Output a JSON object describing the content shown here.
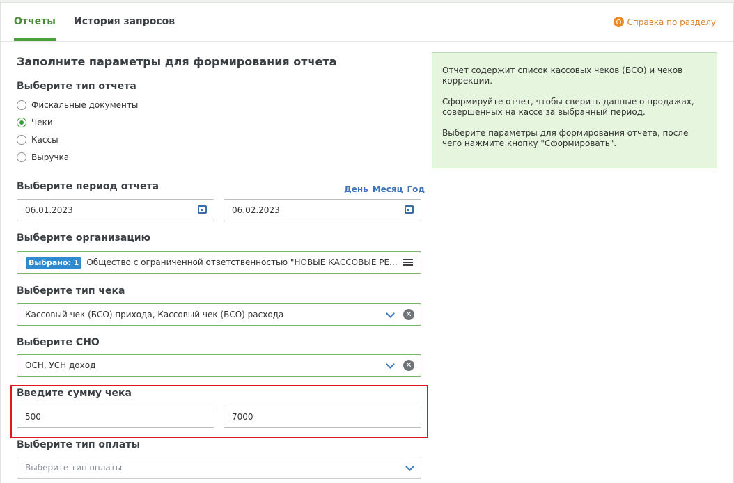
{
  "tabs": [
    {
      "label": "Отчеты",
      "active": true
    },
    {
      "label": "История запросов",
      "active": false
    }
  ],
  "help_link": "Справка по разделу",
  "form": {
    "title": "Заполните параметры для формирования отчета",
    "report_type": {
      "label": "Выберите тип отчета",
      "options": [
        {
          "label": "Фискальные документы",
          "checked": false
        },
        {
          "label": "Чеки",
          "checked": true
        },
        {
          "label": "Кассы",
          "checked": false
        },
        {
          "label": "Выручка",
          "checked": false
        }
      ]
    },
    "period": {
      "label": "Выберите период отчета",
      "quick_links": [
        "День",
        "Месяц",
        "Год"
      ],
      "from": "06.01.2023",
      "to": "06.02.2023"
    },
    "organization": {
      "label": "Выберите организацию",
      "badge": "Выбрано: 1",
      "value": "Общество с ограниченной ответственностью \"НОВЫЕ КАССОВЫЕ РЕ..."
    },
    "receipt_type": {
      "label": "Выберите тип чека",
      "value": "Кассовый чек (БСО) прихода, Кассовый чек (БСО) расхода"
    },
    "tax_system": {
      "label": "Выберите СНО",
      "value": "ОСН, УСН доход"
    },
    "amount": {
      "label": "Введите сумму чека",
      "from": "500",
      "to": "7000"
    },
    "payment_type": {
      "label": "Выберите тип оплаты",
      "placeholder": "Выберите тип оплаты"
    }
  },
  "info": {
    "paragraphs": [
      "Отчет содержит список кассовых чеков (БСО) и чеков коррекции.",
      "Сформируйте отчет, чтобы сверить данные о продажах, совершенных на кассе за выбранный период.",
      "Выберите параметры для формирования отчета, после чего нажмите кнопку \"Сформировать\"."
    ]
  },
  "colors": {
    "accent_green": "#4aa33a",
    "link_blue": "#3f74b6",
    "help_orange": "#e8892b",
    "info_bg": "#e6f5de",
    "highlight_red": "#e0171f"
  }
}
